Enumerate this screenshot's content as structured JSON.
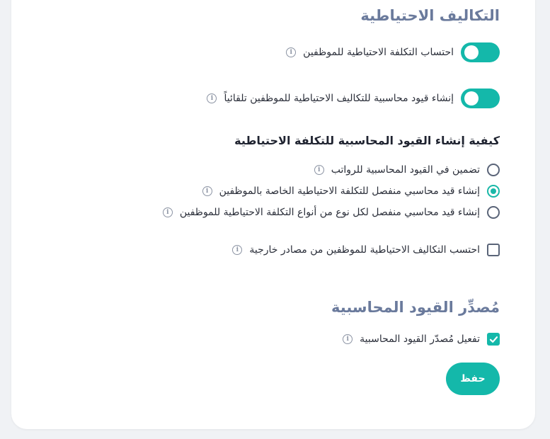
{
  "theme": {
    "accent": "#14b8aa",
    "section_title_color": "#6a7a9c"
  },
  "reserve_costs": {
    "title": "التكاليف الاحتياطية",
    "toggles": [
      {
        "label": "احتساب التكلفة الاحتياطية للموظفين",
        "on": true
      },
      {
        "label": "إنشاء قيود محاسبية للتكاليف الاحتياطية للموظفين تلقائياً",
        "on": true
      }
    ]
  },
  "entry_method": {
    "title": "كيفية إنشاء القيود المحاسبية للتكلفة الاحتياطية",
    "options": [
      {
        "label": "تضمين في القيود المحاسبية للرواتب",
        "selected": false
      },
      {
        "label": "إنشاء قيد محاسبي منفصل للتكلفة الاحتياطية الخاصة بالموظفين",
        "selected": true
      },
      {
        "label": "إنشاء قيد محاسبي منفصل لكل نوع من أنواع التكلفة الاحتياطية للموظفين",
        "selected": false
      }
    ],
    "external_checkbox": {
      "label": "احتسب التكاليف الاحتياطية للموظفين من مصادر خارجية",
      "checked": false
    }
  },
  "entries_source": {
    "title": "مُصدِّر القيود المحاسبية",
    "enable_checkbox": {
      "label": "تفعيل مُصدّر القيود المحاسبية",
      "checked": true
    }
  },
  "save_label": "حفظ",
  "icons": {
    "info": "info-icon",
    "check": "check-icon"
  }
}
